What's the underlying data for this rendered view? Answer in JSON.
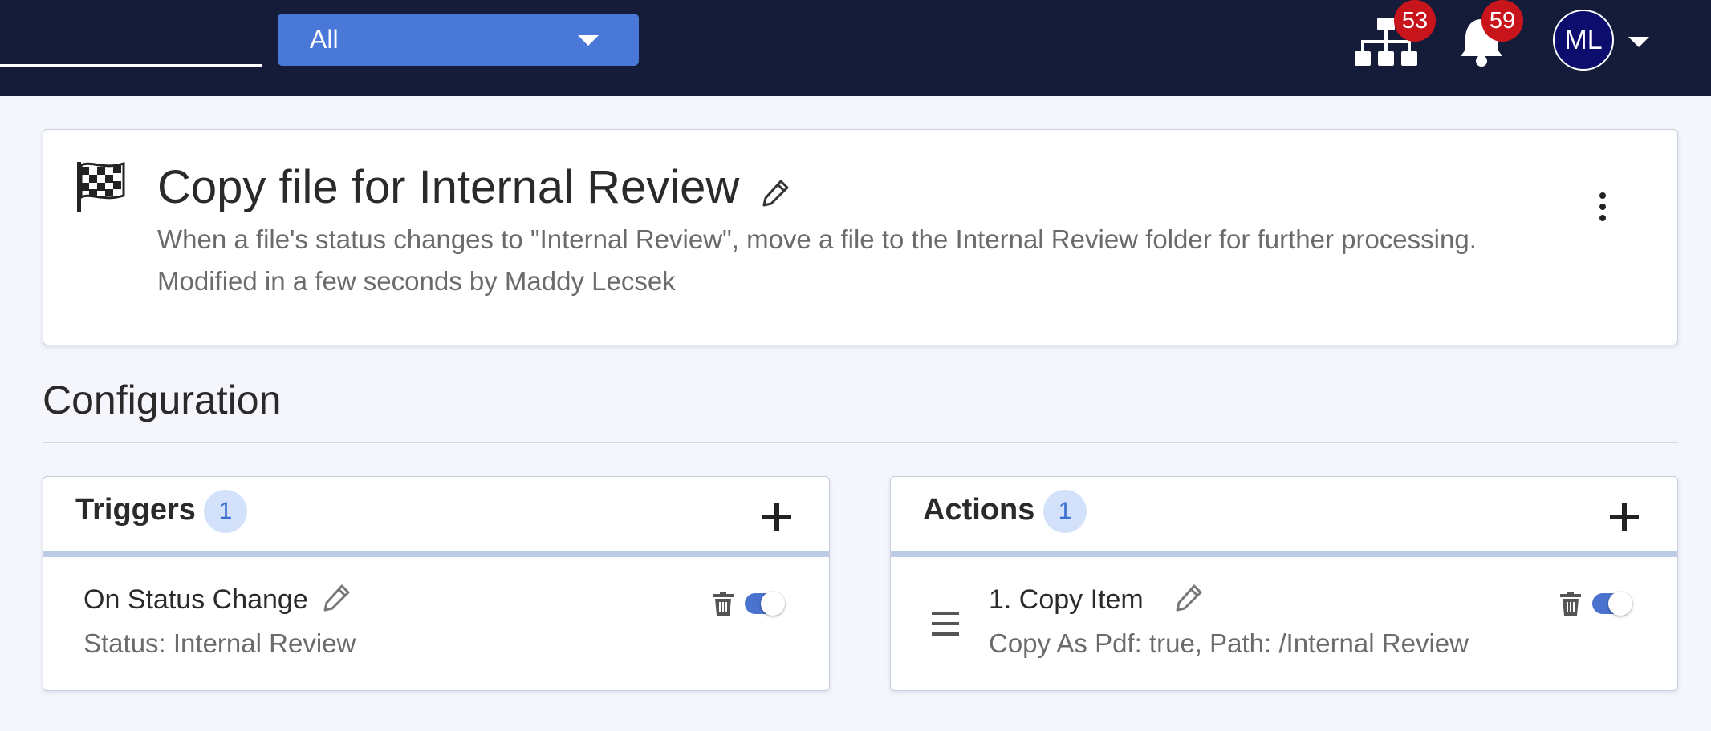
{
  "topbar": {
    "filter": {
      "selected": "All"
    },
    "org_badge": "53",
    "notifications_badge": "59",
    "user_initials": "ML"
  },
  "workflow": {
    "title": "Copy file for Internal Review",
    "description": "When a file's status changes to \"Internal Review\", move a file to the Internal Review folder for further processing.",
    "modified": "Modified in a few seconds by Maddy Lecsek"
  },
  "configuration": {
    "heading": "Configuration",
    "triggers": {
      "title": "Triggers",
      "count": "1",
      "items": [
        {
          "name": "On Status Change",
          "detail": "Status: Internal Review",
          "enabled": true
        }
      ]
    },
    "actions": {
      "title": "Actions",
      "count": "1",
      "items": [
        {
          "name": "1. Copy Item",
          "detail": "Copy As Pdf: true, Path: /Internal Review",
          "enabled": true
        }
      ]
    }
  },
  "colors": {
    "topbar": "#141c3a",
    "accent": "#4a78d8",
    "badge": "#c8141b",
    "avatar": "#0d0d6e",
    "count_pill": "#d3e2fa"
  },
  "icons": [
    "hierarchy-icon",
    "bell-icon",
    "flag-icon",
    "pencil-icon",
    "kebab-icon",
    "plus-icon",
    "trash-icon",
    "drag-handle-icon",
    "chevron-down-icon"
  ]
}
